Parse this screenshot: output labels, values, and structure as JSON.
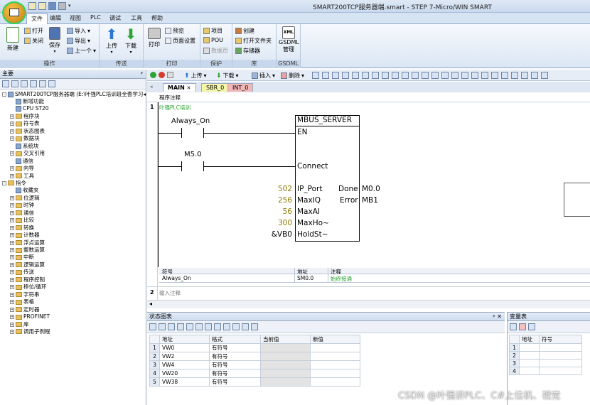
{
  "window": {
    "title": "SMART200TCP服务器端.smart - STEP 7-Micro/WIN SMART"
  },
  "ribbon": {
    "tabs": [
      "文件",
      "编辑",
      "视图",
      "PLC",
      "调试",
      "工具",
      "帮助"
    ],
    "groups": {
      "operation": {
        "label": "操作",
        "new": "新建",
        "open": "打开",
        "close": "关闭",
        "save": "保存",
        "import": "导入",
        "export": "导出",
        "previous": "上一个"
      },
      "transfer": {
        "label": "传送",
        "upload": "上传",
        "download": "下载"
      },
      "print": {
        "label": "打印",
        "print": "打印",
        "preview": "预览",
        "page_setup": "页面设置"
      },
      "protect": {
        "label": "保护",
        "project": "项目",
        "pou": "POU",
        "data_page": "数据页"
      },
      "library": {
        "label": "库",
        "create": "创建",
        "open_folder": "打开文件夹",
        "memory": "存储器"
      },
      "gsdml": {
        "label": "GSDML",
        "manage": "GSDML\n管理",
        "icon_text": "XML"
      }
    }
  },
  "left_panel": {
    "header": "主要",
    "project_root": "SMART200TCP服务器端 (E:\\叶强PLC培训班全套学习◂",
    "items": [
      {
        "label": "新增功能",
        "level": 1,
        "exp": ""
      },
      {
        "label": "CPU ST20",
        "level": 1,
        "exp": ""
      },
      {
        "label": "程序块",
        "level": 1,
        "exp": "+"
      },
      {
        "label": "符号表",
        "level": 1,
        "exp": "+"
      },
      {
        "label": "状态图表",
        "level": 1,
        "exp": "+"
      },
      {
        "label": "数据块",
        "level": 1,
        "exp": "+"
      },
      {
        "label": "系统块",
        "level": 1,
        "exp": ""
      },
      {
        "label": "交叉引用",
        "level": 1,
        "exp": "+"
      },
      {
        "label": "通信",
        "level": 1,
        "exp": ""
      },
      {
        "label": "向导",
        "level": 1,
        "exp": "+"
      },
      {
        "label": "工具",
        "level": 1,
        "exp": "+"
      },
      {
        "label": "指令",
        "level": 0,
        "exp": "-"
      },
      {
        "label": "收藏夹",
        "level": 1,
        "exp": ""
      },
      {
        "label": "位逻辑",
        "level": 1,
        "exp": "+"
      },
      {
        "label": "时钟",
        "level": 1,
        "exp": "+"
      },
      {
        "label": "通信",
        "level": 1,
        "exp": "+"
      },
      {
        "label": "比较",
        "level": 1,
        "exp": "+"
      },
      {
        "label": "转换",
        "level": 1,
        "exp": "+"
      },
      {
        "label": "计数器",
        "level": 1,
        "exp": "+"
      },
      {
        "label": "浮点运算",
        "level": 1,
        "exp": "+"
      },
      {
        "label": "整数运算",
        "level": 1,
        "exp": "+"
      },
      {
        "label": "中断",
        "level": 1,
        "exp": "+"
      },
      {
        "label": "逻辑运算",
        "level": 1,
        "exp": "+"
      },
      {
        "label": "传送",
        "level": 1,
        "exp": "+"
      },
      {
        "label": "程序控制",
        "level": 1,
        "exp": "+"
      },
      {
        "label": "移位/循环",
        "level": 1,
        "exp": "+"
      },
      {
        "label": "字符串",
        "level": 1,
        "exp": "+"
      },
      {
        "label": "表格",
        "level": 1,
        "exp": "+"
      },
      {
        "label": "定时器",
        "level": 1,
        "exp": "+"
      },
      {
        "label": "PROFINET",
        "level": 1,
        "exp": "+"
      },
      {
        "label": "库",
        "level": 1,
        "exp": "+"
      },
      {
        "label": "调用子例程",
        "level": 1,
        "exp": "+"
      }
    ]
  },
  "editor": {
    "toolbar": {
      "upload": "上传",
      "download": "下载",
      "insert": "插入",
      "delete": "删除"
    },
    "tabs": [
      {
        "label": "MAIN",
        "close": "✕"
      },
      {
        "label": "SBR_0"
      },
      {
        "label": "INT_0"
      }
    ],
    "program_comment": "程序注释",
    "network1": {
      "number": "1",
      "comment": "叶强PLC培训",
      "contact1": "Always_On",
      "contact2": "M5.0",
      "block_name": "MBUS_SERVER",
      "pins_left": [
        "EN",
        "Connect",
        "IP_Port",
        "MaxIQ",
        "MaxAI",
        "MaxHo~",
        "HoldSt~"
      ],
      "pins_right": [
        "Done",
        "Error"
      ],
      "values_left": [
        "502",
        "256",
        "56",
        "300",
        "&VB0"
      ],
      "values_right": [
        "M0.0",
        "MB1"
      ],
      "symbol_table": {
        "headers": [
          "符号",
          "地址",
          "注释"
        ],
        "row": {
          "symbol": "Always_On",
          "address": "SM0.0",
          "comment": "始终接通"
        }
      }
    },
    "network2": {
      "number": "2",
      "comment": "输入注释"
    }
  },
  "status_chart": {
    "title": "状态图表",
    "columns": [
      "地址",
      "格式",
      "当前值",
      "新值"
    ],
    "rows": [
      {
        "n": "1",
        "address": "VW0",
        "format": "有符号"
      },
      {
        "n": "2",
        "address": "VW2",
        "format": "有符号"
      },
      {
        "n": "3",
        "address": "VW4",
        "format": "有符号"
      },
      {
        "n": "4",
        "address": "VW20",
        "format": "有符号"
      },
      {
        "n": "5",
        "address": "VW38",
        "format": "有符号"
      }
    ]
  },
  "var_table": {
    "title": "变量表",
    "columns": [
      "地址",
      "符号"
    ],
    "rows": [
      "1",
      "2",
      "3",
      "4"
    ]
  },
  "watermark": "CSDN @叶强讲PLC、C#上位机、视觉"
}
